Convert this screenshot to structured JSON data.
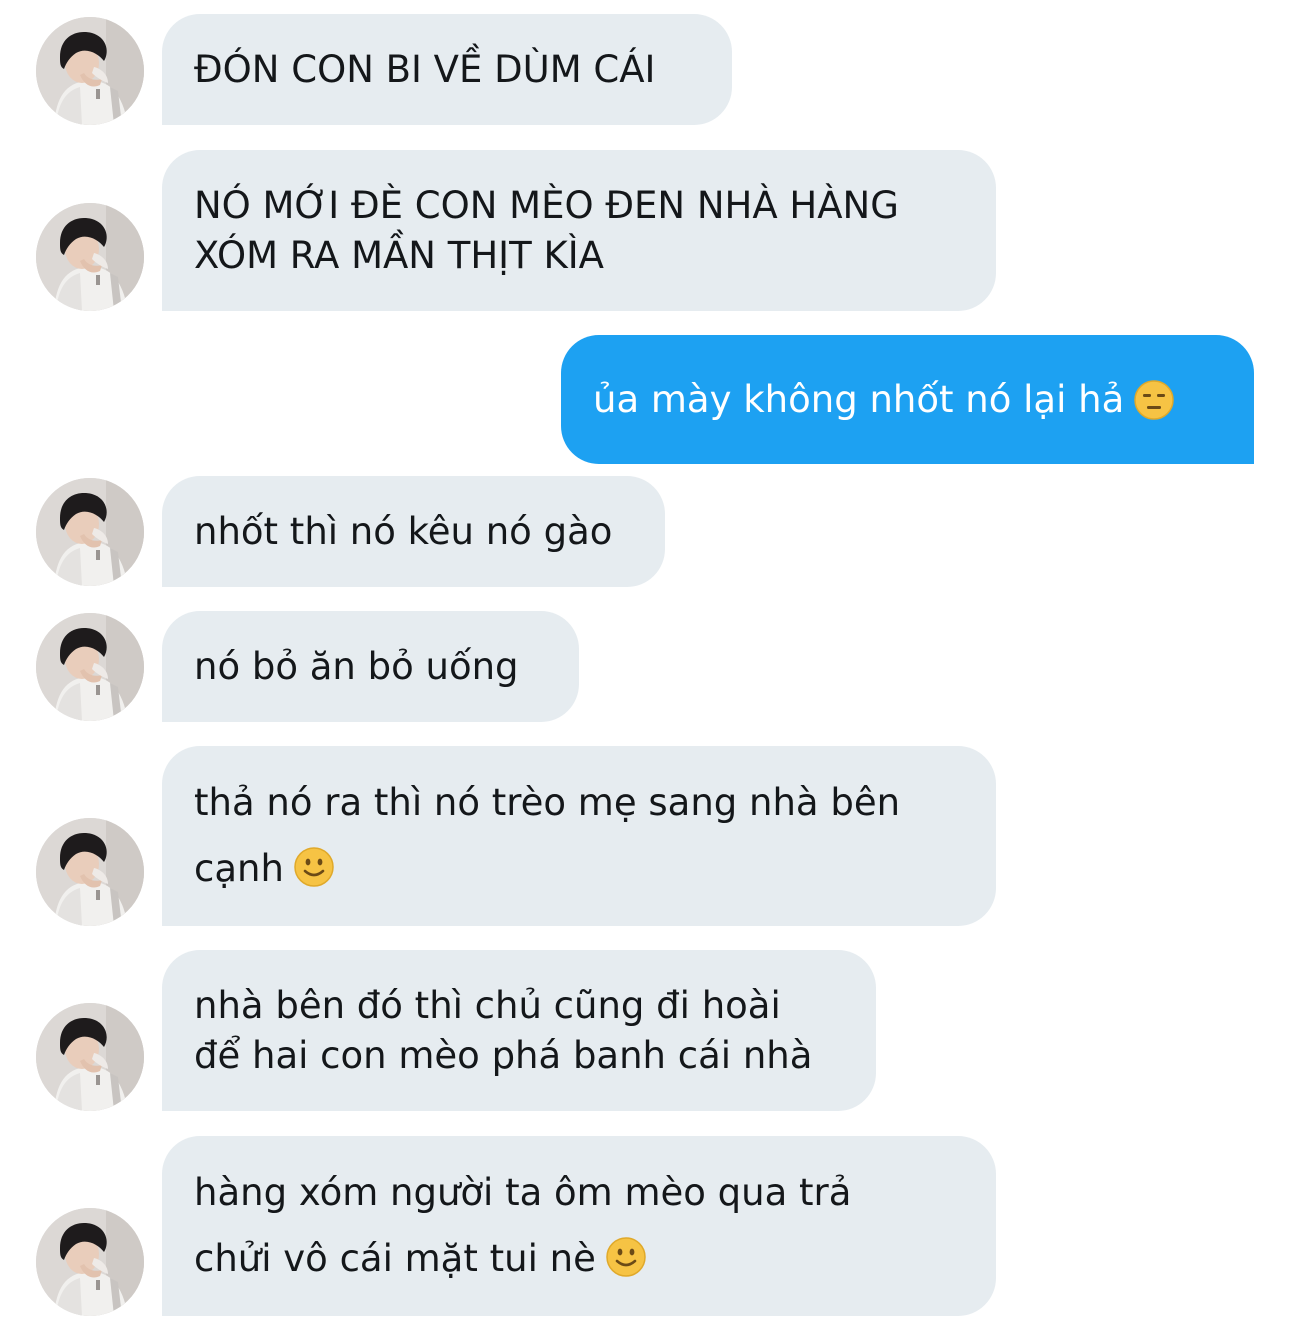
{
  "conversation": {
    "messages": [
      {
        "sender": "contact",
        "text": "ĐÓN CON BI VỀ DÙM CÁI",
        "emoji": ""
      },
      {
        "sender": "contact",
        "text": "NÓ MỚI ĐÈ CON MÈO ĐEN NHÀ HÀNG\nXÓM RA MẦN THỊT KÌA",
        "emoji": ""
      },
      {
        "sender": "me",
        "text": "ủa mày không nhốt nó lại hả",
        "emoji": "expressionless-face-emoji"
      },
      {
        "sender": "contact",
        "text": "nhốt thì nó kêu nó gào",
        "emoji": ""
      },
      {
        "sender": "contact",
        "text": "nó bỏ ăn bỏ uống",
        "emoji": ""
      },
      {
        "sender": "contact",
        "text": "thả nó ra thì nó trèo mẹ sang nhà bên\ncạnh",
        "emoji": "slightly-smiling-face-emoji"
      },
      {
        "sender": "contact",
        "text": "nhà bên đó thì chủ cũng đi hoài\nđể hai con mèo phá banh cái nhà",
        "emoji": ""
      },
      {
        "sender": "contact",
        "text": "hàng xóm người ta ôm mèo qua trả\nchửi vô cái mặt tui nè",
        "emoji": "slightly-smiling-face-emoji"
      }
    ]
  },
  "colors": {
    "incoming_bubble": "#e6ecf0",
    "outgoing_bubble": "#1da1f2",
    "incoming_text": "#14171a",
    "outgoing_text": "#ffffff"
  }
}
